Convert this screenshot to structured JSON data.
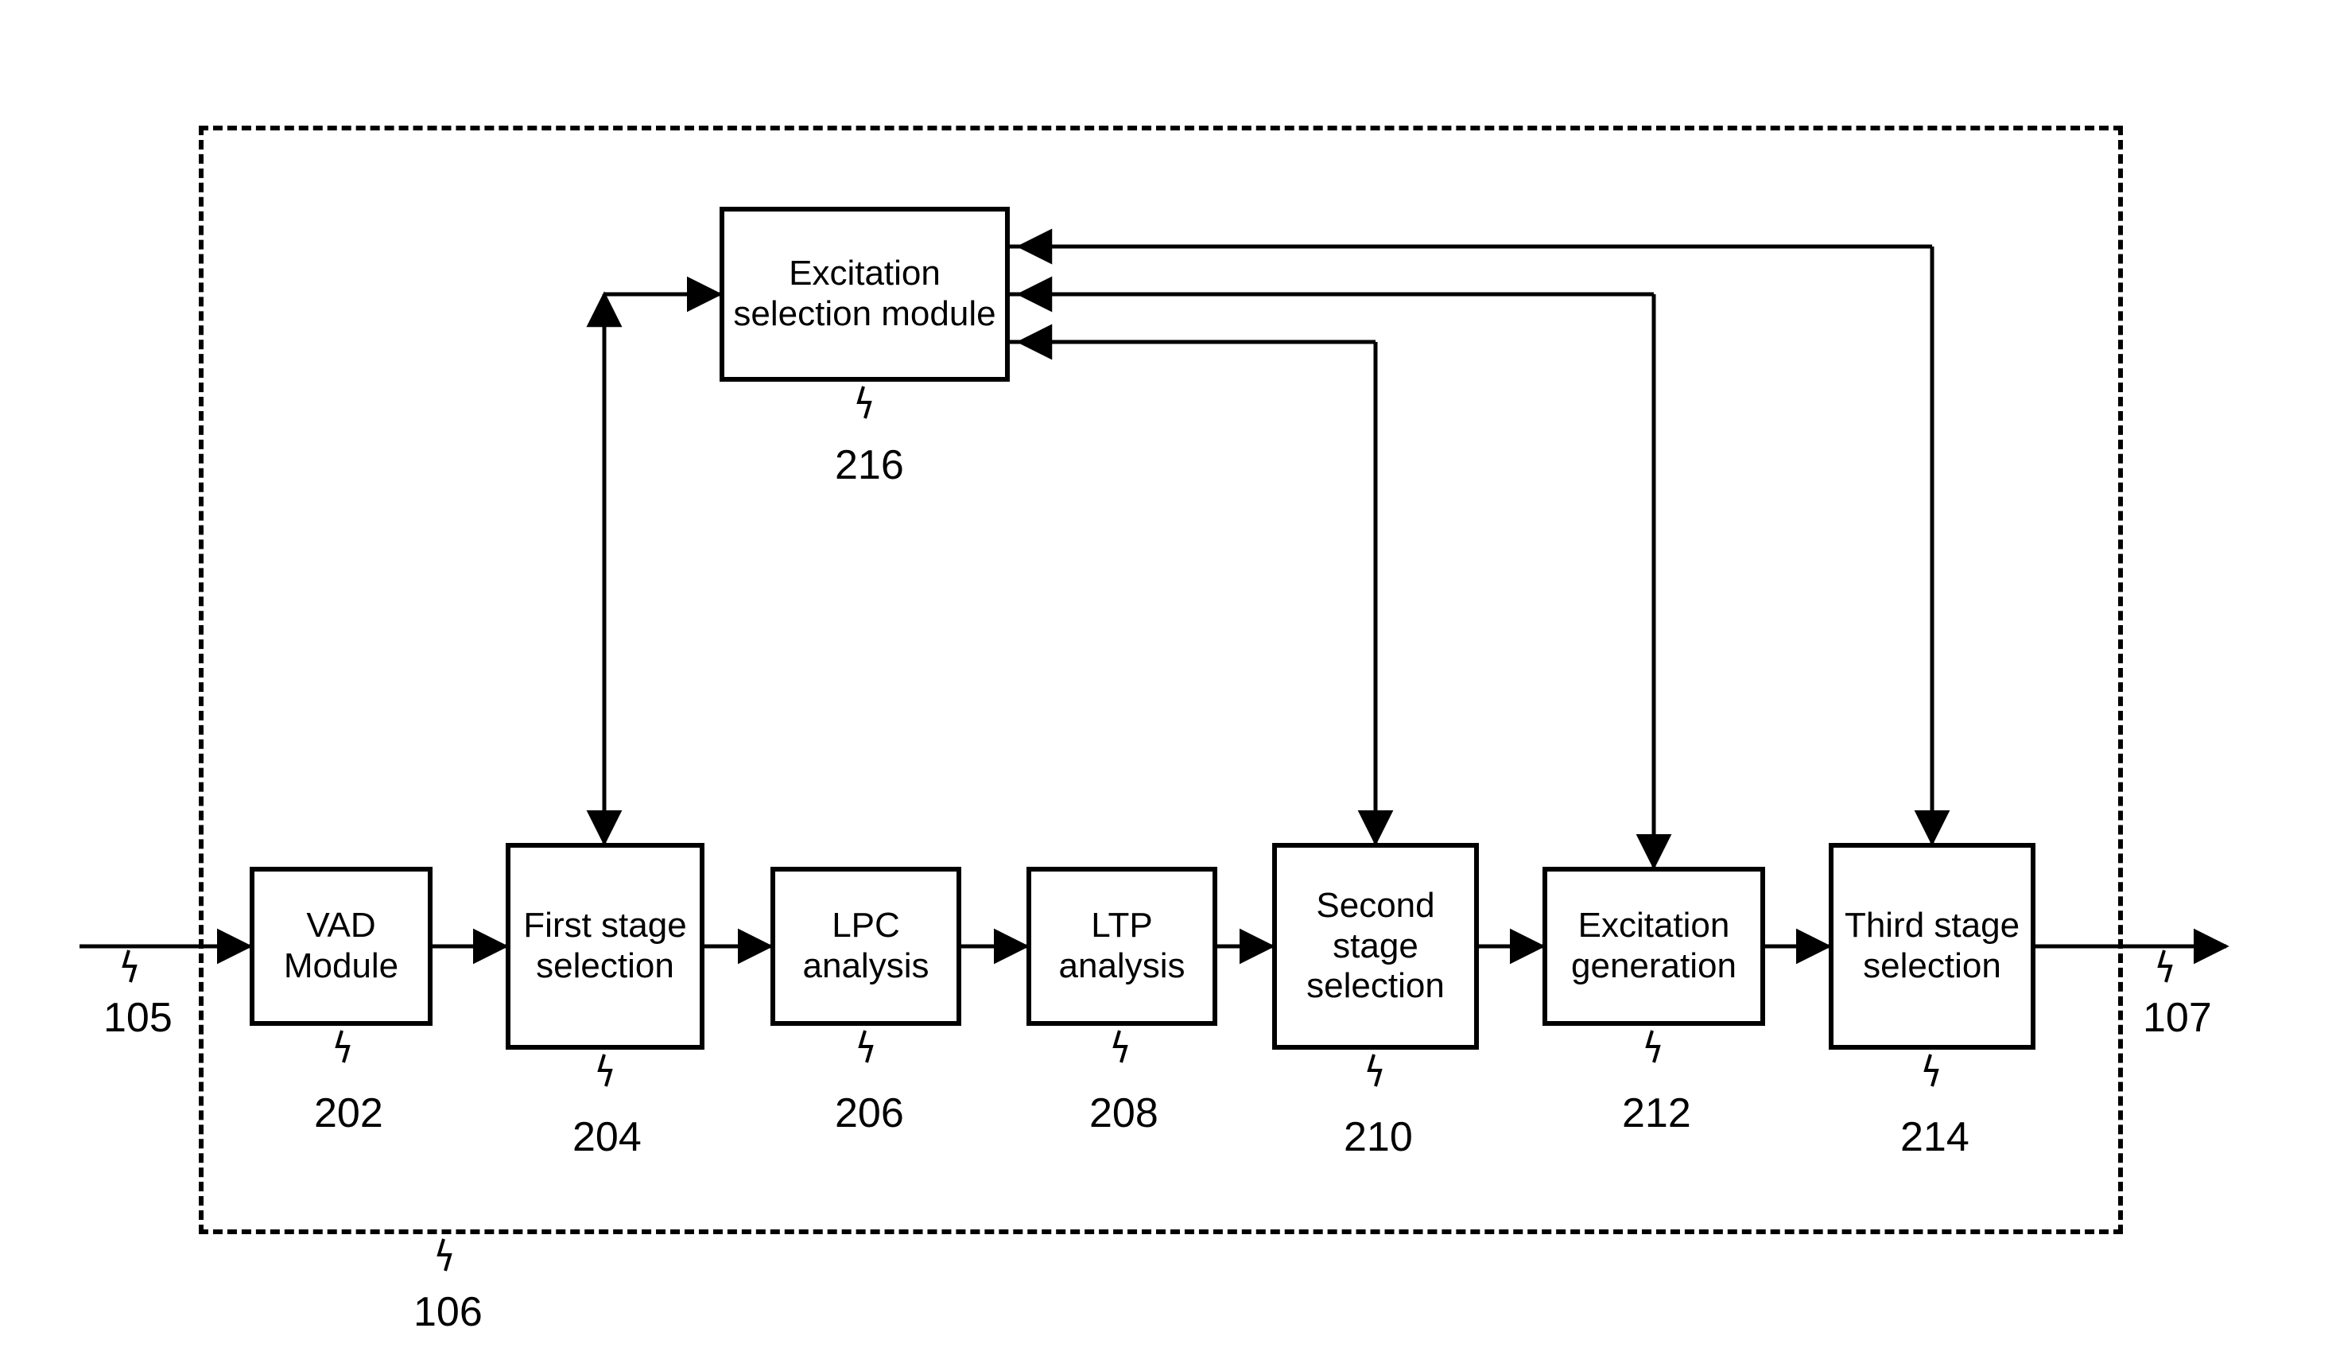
{
  "container_ref": "106",
  "input_ref": "105",
  "output_ref": "107",
  "top_block": {
    "label": "Excitation selection module",
    "ref": "216"
  },
  "row": [
    {
      "label": "VAD Module",
      "ref": "202"
    },
    {
      "label": "First stage selection",
      "ref": "204"
    },
    {
      "label": "LPC analysis",
      "ref": "206"
    },
    {
      "label": "LTP analysis",
      "ref": "208"
    },
    {
      "label": "Second stage selection",
      "ref": "210"
    },
    {
      "label": "Excitation generation",
      "ref": "212"
    },
    {
      "label": "Third stage selection",
      "ref": "214"
    }
  ]
}
